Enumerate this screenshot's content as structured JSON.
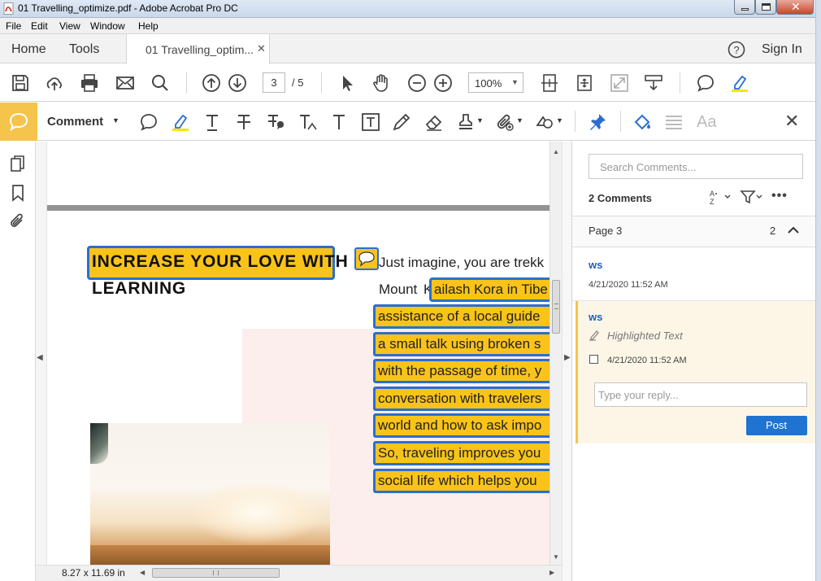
{
  "window": {
    "title": "01 Travelling_optimize.pdf - Adobe Acrobat Pro DC"
  },
  "menu": [
    "File",
    "Edit",
    "View",
    "Window",
    "Help"
  ],
  "nav": {
    "home": "Home",
    "tools": "Tools",
    "tab_title": "01 Travelling_optim...",
    "sign_in": "Sign In"
  },
  "toolbar": {
    "page_current": "3",
    "page_total": "/ 5",
    "zoom": "100%"
  },
  "comment_bar": {
    "label": "Comment"
  },
  "document": {
    "heading_line1": "INCREASE YOUR LOVE WITH",
    "heading_line2": "LEARNING",
    "para_line1": "Just imagine, you are trekk",
    "para_line2_a": "Mount ",
    "para_line2_b": "K",
    "para_line2_c": "ailash Kora in Tibe",
    "highlight_lines": [
      "assistance of a local guide",
      "a small talk using broken s",
      "with the passage of time, y",
      "conversation with travelers",
      "world and how to ask impo",
      "So, traveling improves you",
      "social life which helps you"
    ],
    "page_size": "8.27 x 11.69 in"
  },
  "comments_panel": {
    "search_placeholder": "Search Comments...",
    "count_label": "2 Comments",
    "page_label": "Page 3",
    "page_count": "2",
    "comment1": {
      "author": "ws",
      "date": "4/21/2020  11:52 AM"
    },
    "comment2": {
      "author": "ws",
      "type": "Highlighted Text",
      "date": "4/21/2020  11:52 AM"
    },
    "reply_placeholder": "Type your reply...",
    "post_label": "Post"
  },
  "colors": {
    "accent": "#2a6fcf",
    "highlight": "#f9c31a",
    "comment_badge": "#f4c44b",
    "post_button": "#1f73d1"
  }
}
